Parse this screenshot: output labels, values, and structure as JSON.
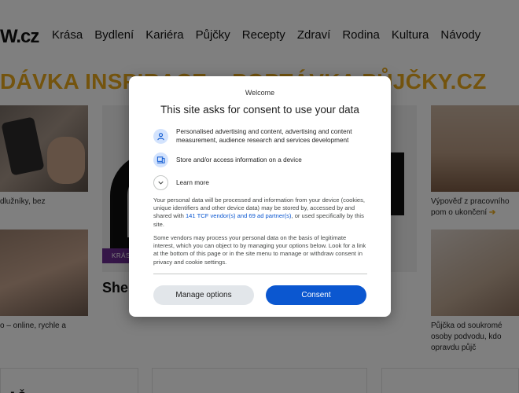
{
  "header": {
    "logo_text": "W.cz",
    "nav": [
      "Krása",
      "Bydlení",
      "Kariéra",
      "Půjčky",
      "Recepty",
      "Zdraví",
      "Rodina",
      "Kultura",
      "Návody"
    ]
  },
  "section": {
    "title": "DÁVKA INSPIRACE – POPTÁVKA PŮJČKY.CZ"
  },
  "cards": {
    "left_top_text": "dlužníky, bez",
    "left_bottom_text": "o – online, rychle a",
    "right_top_text": "Výpověď z pracovního pom o ukončení",
    "right_top_arrow": "➔",
    "right_bottom_text": "Půjčka od soukromé osoby podvodu, kdo opravdu půjč",
    "center_tag": "KRÁSA",
    "center_headline": "Shein"
  },
  "bottom_cards": [
    "J Č",
    "",
    ""
  ],
  "consent": {
    "welcome": "Welcome",
    "title": "This site asks for consent to use your data",
    "purposes": [
      {
        "icon": "person-icon",
        "text": "Personalised advertising and content, advertising and content measurement, audience research and services development"
      },
      {
        "icon": "device-icon",
        "text": "Store and/or access information on a device"
      },
      {
        "icon": "chevron-down-icon",
        "text": "Learn more"
      }
    ],
    "body1_before": "Your personal data will be processed and information from your device (cookies, unique identifiers and other device data) may be stored by, accessed by and shared with ",
    "body1_link": "141 TCF vendor(s) and 69 ad partner(s)",
    "body1_after": ", or used specifically by this site.",
    "body2": "Some vendors may process your personal data on the basis of legitimate interest, which you can object to by managing your options below. Look for a link at the bottom of this page or in the site menu to manage or withdraw consent in privacy and cookie settings.",
    "manage_label": "Manage options",
    "consent_label": "Consent"
  },
  "colors": {
    "accent": "#e8a91c",
    "primary_button": "#0b57d0",
    "tag": "#6a2c91"
  }
}
